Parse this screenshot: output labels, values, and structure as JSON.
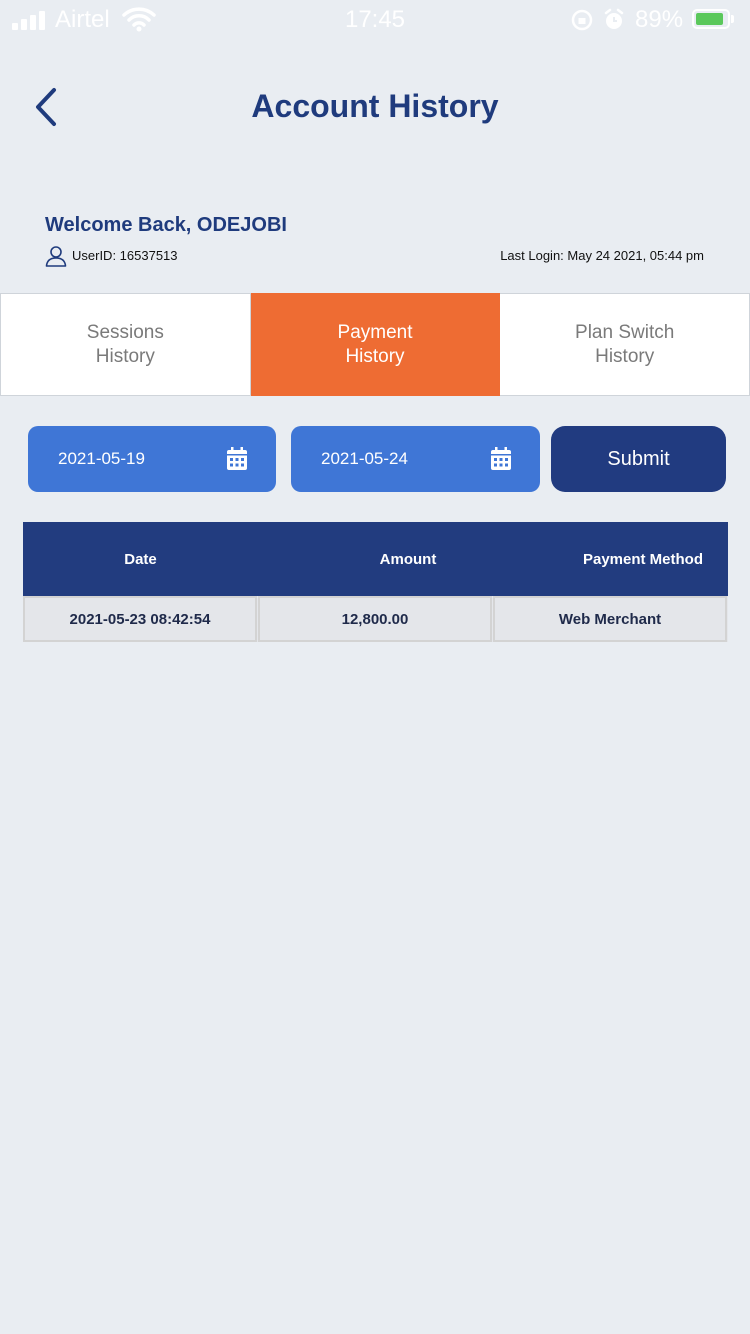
{
  "status_bar": {
    "carrier": "Airtel",
    "time": "17:45",
    "battery_percent": "89%",
    "battery_level": 0.89
  },
  "header": {
    "title": "Account History",
    "back_icon": "chevron-left-icon"
  },
  "welcome": {
    "greeting": "Welcome Back, ODEJOBI",
    "user_id": "UserID: 16537513",
    "last_login": "Last Login: May 24 2021, 05:44 pm"
  },
  "tabs": [
    {
      "label": "Sessions\nHistory",
      "active": false
    },
    {
      "label": "Payment\nHistory",
      "active": true
    },
    {
      "label": "Plan Switch\nHistory",
      "active": false
    }
  ],
  "filters": {
    "start_date": "2021-05-19",
    "end_date": "2021-05-24",
    "submit_label": "Submit",
    "calendar_icon": "calendar-icon"
  },
  "table": {
    "headers": [
      "Date",
      "Amount",
      "Payment Method"
    ],
    "rows": [
      [
        "2021-05-23 08:42:54",
        "12,800.00",
        "Web Merchant"
      ]
    ]
  },
  "colors": {
    "accent_orange": "#ee6c33",
    "primary_blue": "#3f76d6",
    "navy": "#213b80",
    "background": "#e9edf2"
  }
}
